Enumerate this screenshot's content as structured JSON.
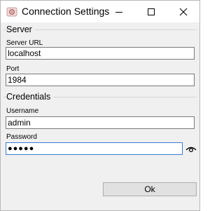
{
  "window": {
    "title": "Connection Settings",
    "icon": "app-settings-icon",
    "controls": [
      "minimize-icon",
      "maximize-icon",
      "close-icon"
    ]
  },
  "server": {
    "group_label": "Server",
    "url_label": "Server URL",
    "url_value": "localhost",
    "port_label": "Port",
    "port_value": "1984"
  },
  "credentials": {
    "group_label": "Credentials",
    "username_label": "Username",
    "username_value": "admin",
    "password_label": "Password",
    "password_masked": "●●●●●",
    "reveal_icon": "eye-icon"
  },
  "buttons": {
    "ok_label": "Ok"
  },
  "colors": {
    "focus_border": "#3b7bd4",
    "button_bg": "#e1e1e1"
  }
}
